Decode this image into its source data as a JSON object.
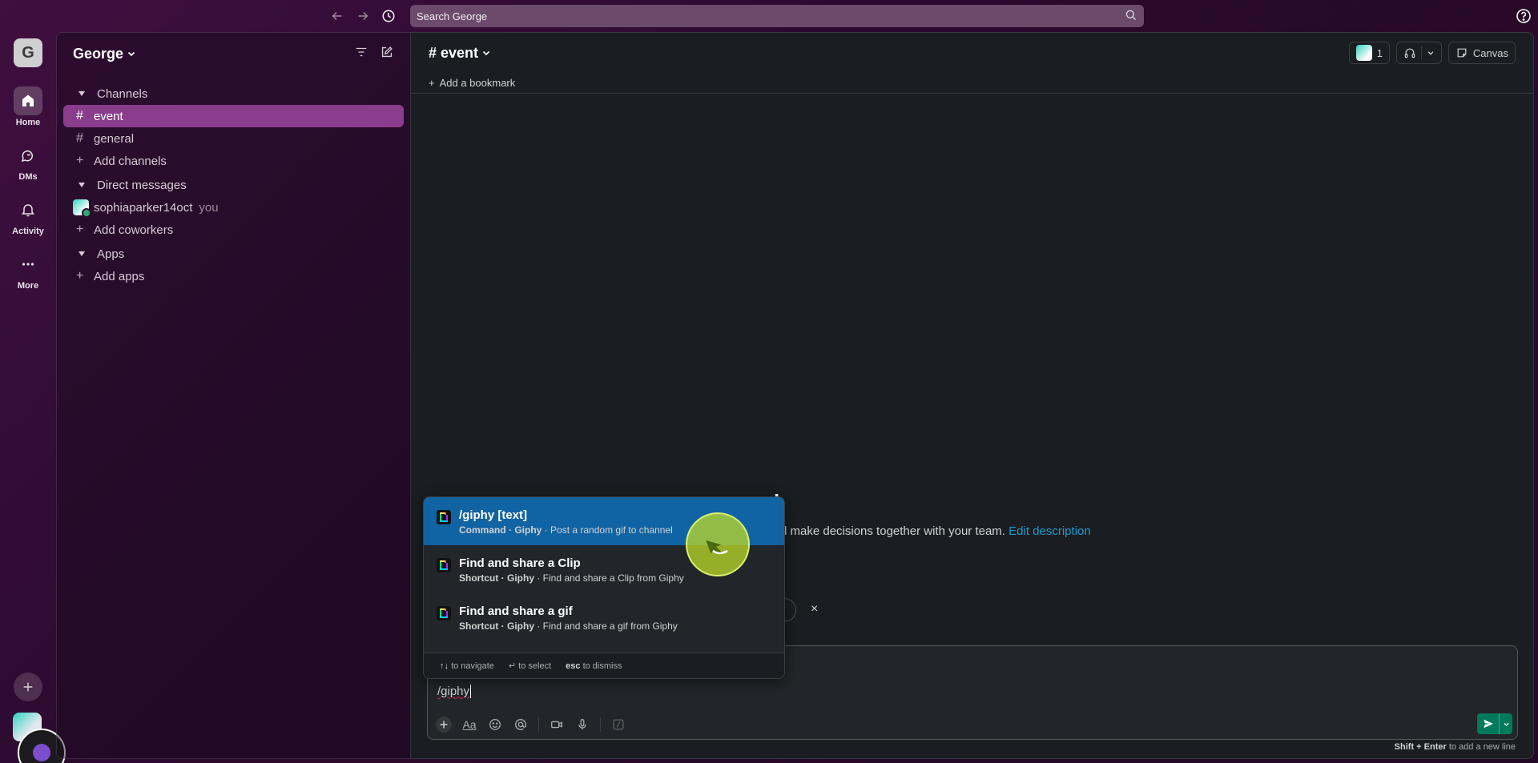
{
  "topbar": {
    "search_placeholder": "Search George",
    "icons": [
      "back-arrow-icon",
      "forward-arrow-icon",
      "history-icon",
      "search-icon",
      "help-icon"
    ]
  },
  "rail": {
    "workspace_initial": "G",
    "items": [
      {
        "label": "Home",
        "icon": "home-icon",
        "active": true
      },
      {
        "label": "DMs",
        "icon": "dms-icon"
      },
      {
        "label": "Activity",
        "icon": "bell-icon"
      },
      {
        "label": "More",
        "icon": "ellipsis-icon"
      }
    ]
  },
  "sidebar": {
    "workspace_name": "George",
    "channels_header": "Channels",
    "channels": [
      {
        "prefix": "#",
        "name": "event",
        "active": true
      },
      {
        "prefix": "#",
        "name": "general"
      }
    ],
    "add_channels": "Add channels",
    "dm_header": "Direct messages",
    "dms": [
      {
        "name": "sophiaparker14oct",
        "suffix": "you"
      }
    ],
    "add_coworkers": "Add coworkers",
    "apps_header": "Apps",
    "add_apps": "Add apps"
  },
  "channel": {
    "title": "# event",
    "member_count": "1",
    "canvas_label": "Canvas",
    "add_bookmark": "Add a bookmark",
    "intro_title_fragment": "l",
    "intro_desc": "d make decisions together with your team.",
    "edit_description": "Edit description",
    "intro_close": "×"
  },
  "popup": {
    "items": [
      {
        "title": "/giphy [text]",
        "kind": "Command · Giphy",
        "desc": "· Post a random gif to channel",
        "active": true
      },
      {
        "title": "Find and share a Clip",
        "kind": "Shortcut · Giphy",
        "desc": "· Find and share a Clip from Giphy"
      },
      {
        "title": "Find and share a gif",
        "kind": "Shortcut · Giphy",
        "desc": "· Find and share a gif from Giphy"
      }
    ],
    "footer": {
      "nav_keys": "↑↓",
      "nav_text": "to navigate",
      "select_key": "↵",
      "select_text": "to select",
      "dismiss_key": "esc",
      "dismiss_text": "to dismiss"
    }
  },
  "composer": {
    "value": "/giphy",
    "format_label": "Aa",
    "hint_keys": "Shift + Enter",
    "hint_text": "to add a new line"
  },
  "colors": {
    "accent_active": "#8a3d8c",
    "popup_selected": "#1164a3",
    "send": "#007a5a",
    "link": "#1d9bd1"
  }
}
